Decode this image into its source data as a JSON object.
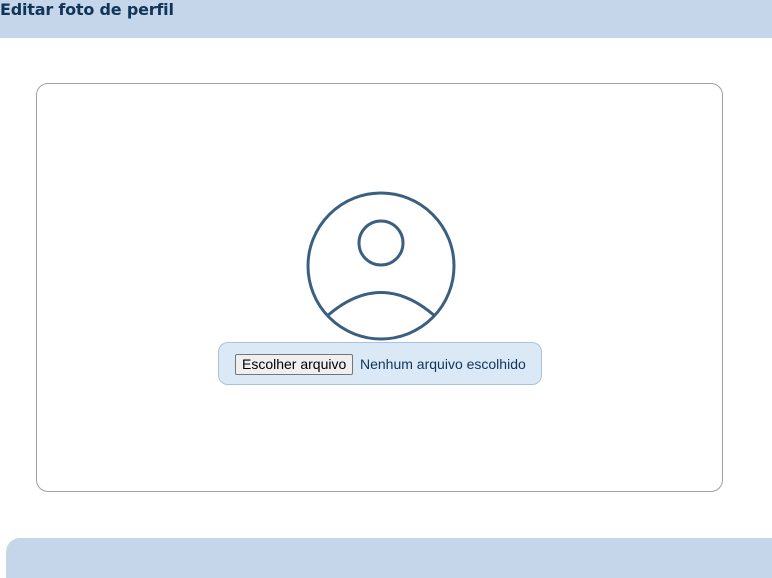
{
  "header": {
    "title": "Editar foto de perfil"
  },
  "upload": {
    "button_label": "Escolher arquivo",
    "status_text": "Nenhum arquivo escolhido"
  },
  "avatar": {
    "icon": "user-circle-icon"
  },
  "colors": {
    "header_bg": "#c5d6ea",
    "title_text": "#0f3559",
    "avatar_stroke": "#3a5f80",
    "upload_bg": "#dbe9f7"
  }
}
